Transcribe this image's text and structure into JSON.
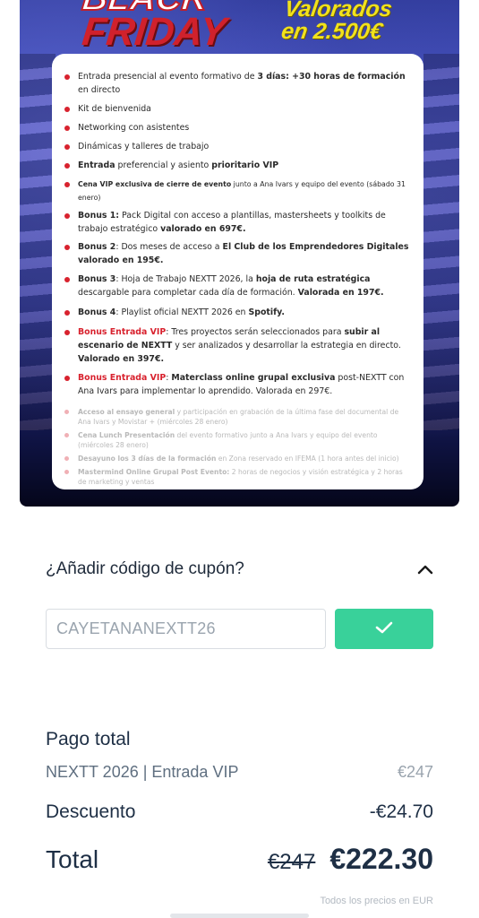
{
  "banner": {
    "title_line1": "BLACK",
    "title_line2": "FRIDAY",
    "valued_line1": "Valorados",
    "valued_line2": "en 2.500€",
    "items": [
      {
        "type": "normal",
        "parts": [
          {
            "t": "Entrada presencial al evento formativo de "
          },
          {
            "t": "3 días: +30 horas de formación",
            "b": true
          },
          {
            "t": " en directo"
          }
        ]
      },
      {
        "type": "normal",
        "parts": [
          {
            "t": "Kit de bienvenida"
          }
        ]
      },
      {
        "type": "normal",
        "parts": [
          {
            "t": "Networking con asistentes"
          }
        ]
      },
      {
        "type": "normal",
        "parts": [
          {
            "t": "Dinámicas y talleres de trabajo"
          }
        ]
      },
      {
        "type": "normal",
        "parts": [
          {
            "t": "Entrada",
            "b": true
          },
          {
            "t": " preferencial y asiento "
          },
          {
            "t": "prioritario VIP",
            "b": true
          }
        ]
      },
      {
        "type": "tiny",
        "parts": [
          {
            "t": "Cena VIP exclusiva de cierre de evento",
            "b": true
          },
          {
            "t": " junto a Ana Ivars y equipo del evento (sábado 31 enero)"
          }
        ]
      },
      {
        "type": "normal",
        "parts": [
          {
            "t": "Bonus 1:",
            "b": true
          },
          {
            "t": " Pack Digital con  acceso a plantillas, mastersheets y toolkits de trabajo estratégico "
          },
          {
            "t": "valorado en 697€.",
            "b": true
          }
        ]
      },
      {
        "type": "normal",
        "parts": [
          {
            "t": "Bonus 2",
            "b": true
          },
          {
            "t": ": Dos meses de acceso a "
          },
          {
            "t": "El Club de los Emprendedores Digitales valorado en 195€.",
            "b": true
          }
        ]
      },
      {
        "type": "normal",
        "parts": [
          {
            "t": "Bonus 3",
            "b": true
          },
          {
            "t": ": Hoja de Trabajo NEXTT 2026, la "
          },
          {
            "t": "hoja de ruta estratégica",
            "b": true
          },
          {
            "t": " descargable para completar cada día de formación. "
          },
          {
            "t": "Valorada en 197€.",
            "b": true
          }
        ]
      },
      {
        "type": "normal",
        "parts": [
          {
            "t": "Bonus 4",
            "b": true
          },
          {
            "t": ": Playlist oficial NEXTT 2026 en "
          },
          {
            "t": "Spotify.",
            "b": true
          }
        ]
      },
      {
        "type": "normal",
        "parts": [
          {
            "t": "Bonus Entrada VIP",
            "b": true,
            "red": true
          },
          {
            "t": ": Tres proyectos serán seleccionados para "
          },
          {
            "t": "subir al escenario de NEXTT",
            "b": true
          },
          {
            "t": " y ser analizados y desarrollar la estrategia en directo. "
          },
          {
            "t": "Valorado en 397€.",
            "b": true
          }
        ]
      },
      {
        "type": "normal",
        "parts": [
          {
            "t": "Bonus Entrada VIP",
            "b": true,
            "red": true
          },
          {
            "t": ": "
          },
          {
            "t": "Materclass online grupal exclusiva",
            "b": true
          },
          {
            "t": " post-NEXTT con Ana Ivars para implementar lo aprendido. Valorada en 297€."
          }
        ]
      },
      {
        "type": "faded",
        "parts": [
          {
            "t": "Acceso al ensayo general",
            "b": true
          },
          {
            "t": " y participación en grabación de la última fase del documental de Ana Ivars y Movistar + (miércoles 28 enero)"
          }
        ]
      },
      {
        "type": "faded",
        "parts": [
          {
            "t": "Cena Lunch Presentación",
            "b": true
          },
          {
            "t": " del evento formativo junto a Ana Ivars y equipo del evento (miércoles 28 enero)"
          }
        ]
      },
      {
        "type": "faded",
        "parts": [
          {
            "t": "Desayuno los 3 días de la formación",
            "b": true
          },
          {
            "t": " en Zona reservado en IFEMA  (1 hora antes del inicio)"
          }
        ]
      },
      {
        "type": "faded",
        "parts": [
          {
            "t": "Mastermind Online Grupal Post Evento:",
            "b": true
          },
          {
            "t": " 2 horas de negocios y visión estratégica y 2 horas de marketing y ventas"
          }
        ]
      }
    ]
  },
  "coupon": {
    "toggle_label": "¿Añadir código de cupón?",
    "toggle_icon": "chevron-up-icon",
    "code_value": "CAYETANANEXTT26",
    "apply_icon": "check-icon",
    "apply_color": "#39d19a"
  },
  "summary": {
    "title": "Pago total",
    "item_label": "NEXTT 2026 | Entrada VIP",
    "item_price": "€247",
    "discount_label": "Descuento",
    "discount_value": "-€24.70",
    "total_label": "Total",
    "total_old": "€247",
    "total_new": "€222.30",
    "currency_note": "Todos los precios en EUR"
  },
  "colors": {
    "brand_red": "#d8222e",
    "text_dark": "#1e2f45",
    "accent_green": "#39d19a"
  }
}
